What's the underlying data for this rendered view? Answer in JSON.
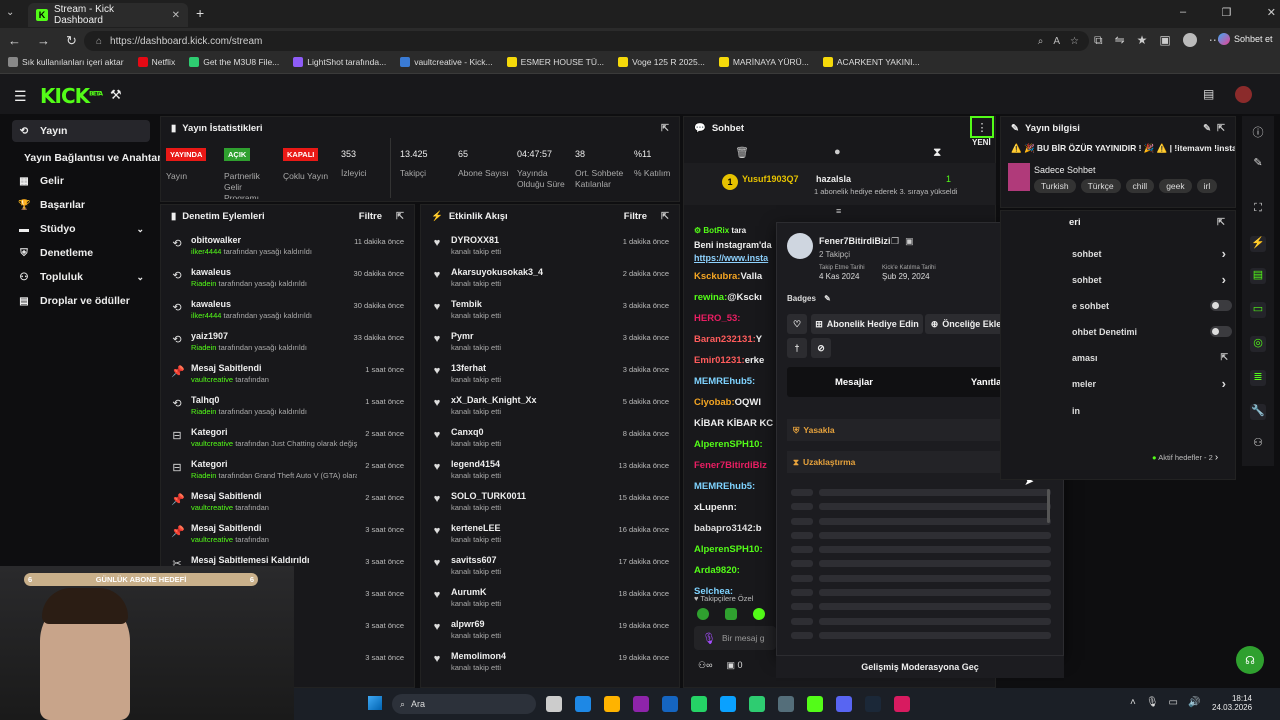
{
  "browser": {
    "tab_title": "Stream - Kick Dashboard",
    "url": "https://dashboard.kick.com/stream",
    "right_label": "Sohbet et",
    "bookmarks": [
      {
        "label": "Sık kullanılanları içeri aktar",
        "color": "#888888"
      },
      {
        "label": "Netflix",
        "color": "#e50914"
      },
      {
        "label": "Get the M3U8 File...",
        "color": "#2ecc71"
      },
      {
        "label": "LightShot tarafında...",
        "color": "#8e5cf7"
      },
      {
        "label": "vaultcreative - Kick...",
        "color": "#3a7bd5"
      },
      {
        "label": "ESMER HOUSE TÜ...",
        "color": "#f5d90a"
      },
      {
        "label": "Voge 125 R 2025...",
        "color": "#f5d90a"
      },
      {
        "label": "MARİNAYA YÜRÜ...",
        "color": "#f5d90a"
      },
      {
        "label": "ACARKENT YAKINI...",
        "color": "#f5d90a"
      }
    ]
  },
  "header": {
    "logo": "KICK",
    "beta": "BETA"
  },
  "sidebar": {
    "items": [
      {
        "label": "Yayın",
        "icon": "stream-icon"
      },
      {
        "label": "Yayın Bağlantısı ve Anahtarı",
        "icon": ""
      },
      {
        "label": "Gelir",
        "icon": "wallet-icon"
      },
      {
        "label": "Başarılar",
        "icon": "trophy-icon"
      },
      {
        "label": "Stüdyo",
        "icon": "studio-icon"
      },
      {
        "label": "Denetleme",
        "icon": "shield-icon"
      },
      {
        "label": "Topluluk",
        "icon": "community-icon"
      },
      {
        "label": "Droplar ve ödüller",
        "icon": "gift-icon"
      }
    ]
  },
  "stats": {
    "title": "Yayın İstatistikleri",
    "badges": [
      {
        "label": "YAYINDA",
        "color": "#e91916"
      },
      {
        "label": "AÇIK",
        "color": "#2fa02f"
      },
      {
        "label": "KAPALI",
        "color": "#e91916"
      }
    ],
    "badge_labels": [
      "Yayın",
      "Partnerlik Gelir Programı",
      "Çoklu Yayın"
    ],
    "values": [
      "353",
      "13.425",
      "65",
      "04:47:57",
      "38",
      "%11"
    ],
    "labels": [
      "İzleyici",
      "Takipçi",
      "Abone Sayısı",
      "Yayında Olduğu Süre",
      "Ort. Sohbete Katılanlar",
      "% Katılım"
    ]
  },
  "moderation": {
    "title": "Denetim Eylemleri",
    "filter": "Filtre",
    "items": [
      {
        "name": "obitowalker",
        "by": "ilker4444",
        "rest": " tarafından yasağı kaldırıldı",
        "time": "11 dakika önce",
        "icon": "undo-icon"
      },
      {
        "name": "kawaleus",
        "by": "Riadein",
        "rest": " tarafından yasağı kaldırıldı",
        "time": "30 dakika önce",
        "icon": "undo-icon"
      },
      {
        "name": "kawaleus",
        "by": "ilker4444",
        "rest": " tarafından yasağı kaldırıldı",
        "time": "30 dakika önce",
        "icon": "undo-icon"
      },
      {
        "name": "yaiz1907",
        "by": "Riadein",
        "rest": " tarafından yasağı kaldırıldı",
        "time": "33 dakika önce",
        "icon": "undo-icon"
      },
      {
        "name": "Mesaj Sabitlendi",
        "by": "vaultcreative",
        "rest": " tarafından",
        "time": "1 saat önce",
        "icon": "pin-icon"
      },
      {
        "name": "Talhq0",
        "by": "Riadein",
        "rest": " tarafından yasağı kaldırıldı",
        "time": "1 saat önce",
        "icon": "undo-icon"
      },
      {
        "name": "Kategori",
        "by": "vaultcreative",
        "rest": " tarafından Just Chatting olarak değiştirildi",
        "time": "2 saat önce",
        "icon": "category-icon"
      },
      {
        "name": "Kategori",
        "by": "Riadein",
        "rest": " tarafından Grand Theft Auto V (GTA) olarak değiştirildi",
        "time": "2 saat önce",
        "icon": "category-icon"
      },
      {
        "name": "Mesaj Sabitlendi",
        "by": "vaultcreative",
        "rest": " tarafından",
        "time": "2 saat önce",
        "icon": "pin-icon"
      },
      {
        "name": "Mesaj Sabitlendi",
        "by": "vaultcreative",
        "rest": " tarafından",
        "time": "3 saat önce",
        "icon": "pin-icon"
      },
      {
        "name": "Mesaj Sabitlemesi Kaldırıldı",
        "by": "",
        "rest": "",
        "time": "3 saat önce",
        "icon": "unpin-icon"
      },
      {
        "name": "",
        "by": "",
        "rest": "",
        "time": "3 saat önce",
        "icon": ""
      },
      {
        "name": "",
        "by": "",
        "rest": "",
        "time": "3 saat önce",
        "icon": ""
      },
      {
        "name": "",
        "by": "",
        "rest": "",
        "time": "3 saat önce",
        "icon": ""
      }
    ]
  },
  "activity": {
    "title": "Etkinlik Akışı",
    "filter": "Filtre",
    "items": [
      {
        "name": "DYROXX81",
        "sub": "kanalı takip etti",
        "time": "1 dakika önce"
      },
      {
        "name": "Akarsuyokusokak3_4",
        "sub": "kanalı takip etti",
        "time": "2 dakika önce"
      },
      {
        "name": "Tembik",
        "sub": "kanalı takip etti",
        "time": "3 dakika önce"
      },
      {
        "name": "Pymr",
        "sub": "kanalı takip etti",
        "time": "3 dakika önce"
      },
      {
        "name": "13ferhat",
        "sub": "kanalı takip etti",
        "time": "3 dakika önce"
      },
      {
        "name": "xX_Dark_Knight_Xx",
        "sub": "kanalı takip etti",
        "time": "5 dakika önce"
      },
      {
        "name": "Canxq0",
        "sub": "kanalı takip etti",
        "time": "8 dakika önce"
      },
      {
        "name": "legend4154",
        "sub": "kanalı takip etti",
        "time": "13 dakika önce"
      },
      {
        "name": "SOLO_TURK0011",
        "sub": "kanalı takip etti",
        "time": "15 dakika önce"
      },
      {
        "name": "kerteneLEE",
        "sub": "kanalı takip etti",
        "time": "16 dakika önce"
      },
      {
        "name": "savitss607",
        "sub": "kanalı takip etti",
        "time": "17 dakika önce"
      },
      {
        "name": "AurumK",
        "sub": "kanalı takip etti",
        "time": "18 dakika önce"
      },
      {
        "name": "alpwr69",
        "sub": "kanalı takip etti",
        "time": "19 dakika önce"
      },
      {
        "name": "Memolimon4",
        "sub": "kanalı takip etti",
        "time": "19 dakika önce"
      }
    ]
  },
  "chat": {
    "title": "Sohbet",
    "yeni": "YENİ",
    "gift_user": "Yusuf1903Q7",
    "gift_target": "hazalsla",
    "gift_text": "1 abonelik hediye ederek 3. sıraya yükseldi",
    "gift_count": "1",
    "botrix_name": "BotRix",
    "botrix_pre": "tara",
    "bot_line1": "Beni instagram'da",
    "bot_line2": "https://www.insta",
    "messages": [
      {
        "user": "Ksckubra:",
        "text": " Valla",
        "color": "#f5a623"
      },
      {
        "user": "rewina:",
        "text": " @Ksckı",
        "color": "#53fc18"
      },
      {
        "user": "HERO_53:",
        "text": "",
        "color": "#e91e63"
      },
      {
        "user": "Baran232131:",
        "text": " Y",
        "color": "#ff5c5c"
      },
      {
        "user": "Emir01231:",
        "text": " erke",
        "color": "#ff5c5c"
      },
      {
        "user": "MEMREhub5:",
        "text": "",
        "color": "#7fd3ff"
      },
      {
        "user": "Ciyobab:",
        "text": " OQWI",
        "color": "#f5a623"
      },
      {
        "user": "KİBAR KİBAR KC",
        "text": "",
        "color": "#eeeeee"
      },
      {
        "user": "AlperenSPH10:",
        "text": "",
        "color": "#53fc18"
      },
      {
        "user": "Fener7BitirdiBiz",
        "text": "",
        "color": "#e91e63"
      },
      {
        "user": "MEMREhub5:",
        "text": "",
        "color": "#7fd3ff"
      },
      {
        "user": "xLupenn:",
        "text": "",
        "color": "#eeeeee"
      },
      {
        "user": "babapro3142:",
        "text": " b",
        "color": "#dddddd"
      },
      {
        "user": "AlperenSPH10:",
        "text": "",
        "color": "#53fc18"
      },
      {
        "user": "Arda9820:",
        "text": "",
        "color": "#53fc18"
      },
      {
        "user": "Selchea:",
        "text": "",
        "color": "#7fd3ff"
      }
    ],
    "followers_only": "Takipçilere Özel",
    "input_placeholder": "Bir mesaj g",
    "footer_count": "0",
    "advanced_mod": "Gelişmiş Moderasyona Geç"
  },
  "user_card": {
    "name": "Fener7BitirdiBizi",
    "followers": "2 Takipçi",
    "follow_date_label": "Takip Etme Tarihi",
    "follow_date": "4 Kas 2024",
    "join_label": "Kick'e Katılma Tarihi",
    "join_date": "Şub 29, 2024",
    "badges_label": "Badges",
    "gift_sub": "Abonelik Hediye Edin",
    "priority": "Önceliğe Ekle",
    "tab_messages": "Mesajlar",
    "tab_replies": "Yanıtlar",
    "ban": "Yasakla",
    "timeout": "Uzaklaştırma"
  },
  "stream_info": {
    "title": "Yayın bilgisi",
    "stream_title": "⚠️ 🎉 BU BİR ÖZÜR YAYINIDIR ! 🎉 ⚠️ | !itemavm !insta",
    "category": "Sadece Sohbet",
    "tags": [
      "Turkish",
      "Türkçe",
      "chill",
      "geek",
      "irl"
    ]
  },
  "settings_panel": {
    "header": "eri",
    "items": [
      "sohbet",
      "sohbet",
      "e sohbet",
      "ohbet Denetimi",
      "aması",
      "meler",
      "in"
    ],
    "active_goals": "Aktif hedefler - 2"
  },
  "overlay": {
    "goal_label": "GÜNLÜK ABONE HEDEFİ",
    "goal_left": "6",
    "goal_right": "6"
  },
  "taskbar": {
    "search": "Ara",
    "time": "18:14",
    "date": "24.03.2026"
  }
}
